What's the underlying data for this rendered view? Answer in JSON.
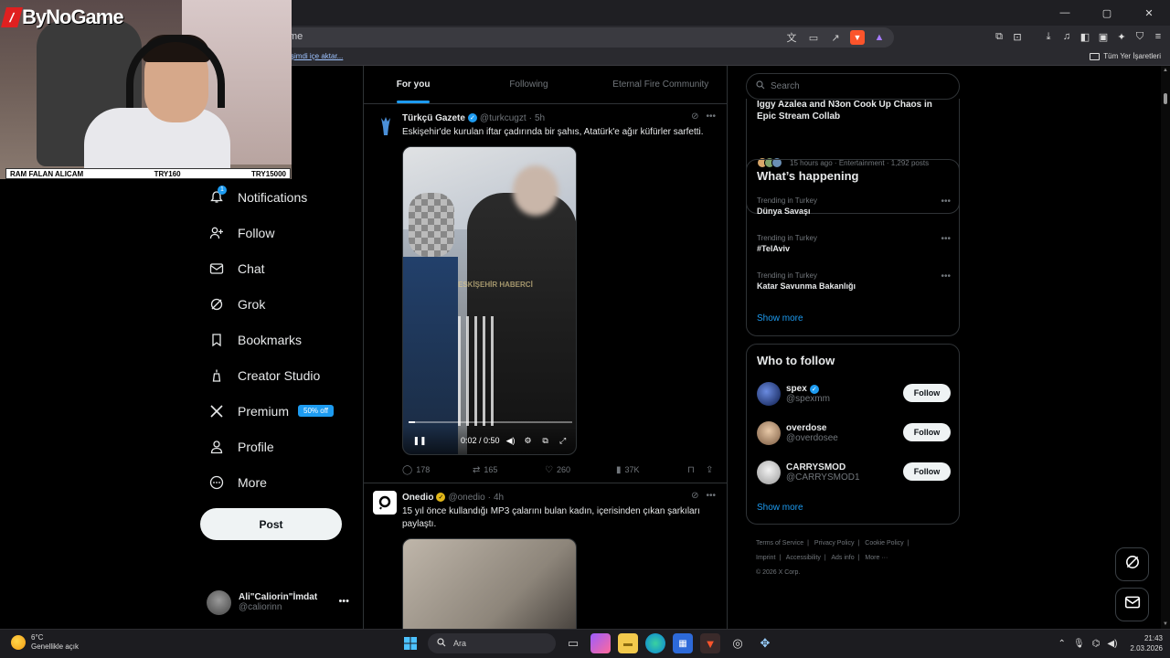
{
  "browser": {
    "url_text": "me",
    "bookmark_import": "şimdi içe aktar...",
    "bookmark_all": "Tüm Yer İşaretleri",
    "window_controls": [
      "—",
      "▢",
      "✕"
    ]
  },
  "stream": {
    "logo_text": "ByNoGame",
    "donation_left": "RAM FALAN ALICAM",
    "donation_mid": "TRY160",
    "donation_right": "TRY15000"
  },
  "nav": {
    "items": [
      {
        "label": "Notifications",
        "icon": "bell-icon",
        "badge": "1"
      },
      {
        "label": "Follow",
        "icon": "person-add-icon"
      },
      {
        "label": "Chat",
        "icon": "mail-icon"
      },
      {
        "label": "Grok",
        "icon": "grok-icon"
      },
      {
        "label": "Bookmarks",
        "icon": "bookmark-icon"
      },
      {
        "label": "Creator Studio",
        "icon": "creator-studio-icon"
      },
      {
        "label": "Premium",
        "icon": "x-logo-icon",
        "badge": "50% off"
      },
      {
        "label": "Profile",
        "icon": "person-icon"
      },
      {
        "label": "More",
        "icon": "more-circle-icon"
      }
    ],
    "post_label": "Post",
    "account_name": "Ali\"Caliorin\"İmdat",
    "account_handle": "@caliorinn"
  },
  "feed": {
    "tabs": [
      "For you",
      "Following",
      "Eternal Fire Community"
    ],
    "active_tab": "For you",
    "tweets": [
      {
        "name": "Türkçü Gazete",
        "handle": "@turkcugzt",
        "time": "5h",
        "text": "Eskişehir'de kurulan iftar çadırında bir şahıs, Atatürk'e ağır küfürler sarfetti.",
        "watermark": "ESKİŞEHİR HABERCİ",
        "video_time": "0:02 / 0:50",
        "progress": 0.04,
        "replies": "178",
        "reposts": "165",
        "likes": "260",
        "views": "37K"
      },
      {
        "name": "Onedio",
        "handle": "@onedio",
        "time": "4h",
        "text": "15 yıl önce kullandığı MP3 çalarını bulan kadın, içerisinden çıkan şarkıları paylaştı."
      }
    ]
  },
  "right": {
    "search_placeholder": "Search",
    "news_title": "Iggy Azalea and N3on Cook Up Chaos in Epic Stream Collab",
    "news_meta": "15 hours ago · Entertainment · 1,292 posts",
    "happening_title": "What’s happening",
    "trends": [
      {
        "category": "Trending in Turkey",
        "name": "Dünya Savaşı"
      },
      {
        "category": "Trending in Turkey",
        "name": "#TelAviv"
      },
      {
        "category": "Trending in Turkey",
        "name": "Katar Savunma Bakanlığı"
      }
    ],
    "show_more": "Show more",
    "wtf_title": "Who to follow",
    "follow_suggestions": [
      {
        "name": "spex",
        "handle": "@spexmm",
        "verified": true
      },
      {
        "name": "overdose",
        "handle": "@overdosee",
        "verified": false
      },
      {
        "name": "CARRYSMOD",
        "handle": "@CARRYSMOD1",
        "verified": false
      }
    ],
    "follow_label": "Follow",
    "footer": [
      "Terms of Service",
      "Privacy Policy",
      "Cookie Policy",
      "Imprint",
      "Accessibility",
      "Ads info",
      "More ···",
      "© 2026 X Corp."
    ]
  },
  "taskbar": {
    "temp": "6°C",
    "weather": "Genellikle açık",
    "search_label": "Ara",
    "time": "21:43",
    "date": "2.03.2026"
  },
  "colors": {
    "accent": "#1d9bf0",
    "background": "#000000",
    "border": "#2f3336",
    "muted": "#71767b"
  }
}
